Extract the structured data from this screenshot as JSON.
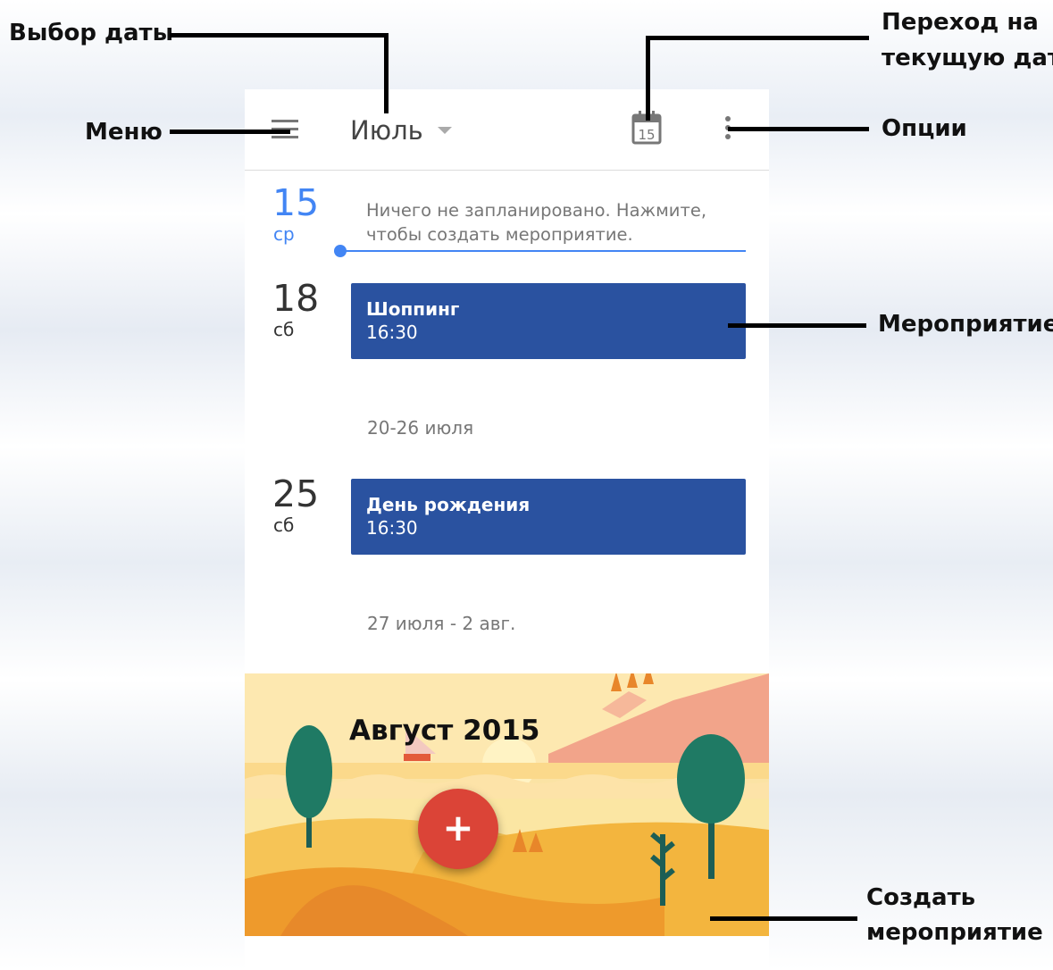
{
  "annotations": {
    "date_picker": "Выбор даты",
    "go_to_today_line1": "Переход на",
    "go_to_today_line2": "текущую дату",
    "menu": "Меню",
    "options": "Опции",
    "event": "Мероприятие",
    "create_line1": "Создать",
    "create_line2": "мероприятие"
  },
  "app_bar": {
    "month": "Июль",
    "today_icon_day": "15",
    "icons": [
      "menu-icon",
      "dropdown-caret-icon",
      "calendar-today-icon",
      "overflow-menu-icon"
    ]
  },
  "schedule": {
    "today": {
      "day_number": "15",
      "day_name": "ср",
      "empty_line1": "Ничего не запланировано. Нажмите,",
      "empty_line2": "чтобы создать мероприятие."
    },
    "days": [
      {
        "day_number": "18",
        "day_name": "сб",
        "event_title": "Шоппинг",
        "event_time": "16:30"
      },
      {
        "day_number": "25",
        "day_name": "сб",
        "event_title": "День рождения",
        "event_time": "16:30"
      }
    ],
    "week_headers": [
      "20-26 июля",
      "27 июля - 2 авг."
    ]
  },
  "month_banner": {
    "title": "Август 2015"
  },
  "fab": {
    "label": "+",
    "icon": "add-icon"
  },
  "colors": {
    "accent_blue": "#4285f4",
    "event_blue": "#2a52a0",
    "fab_red": "#db4437"
  }
}
